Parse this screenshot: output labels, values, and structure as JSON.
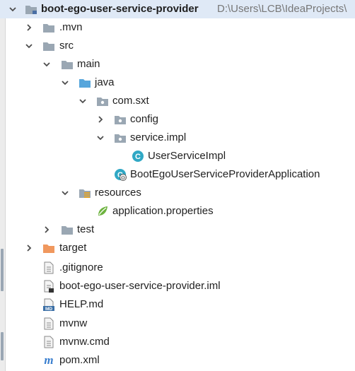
{
  "project_tree": {
    "root": {
      "name": "boot-ego-user-service-provider",
      "path": "D:\\Users\\LCB\\IdeaProjects\\"
    },
    "items": [
      {
        "name": ".mvn",
        "icon": "folder-icon",
        "state": "collapsed"
      },
      {
        "name": "src",
        "icon": "folder-icon",
        "state": "expanded"
      },
      {
        "name": "main",
        "icon": "folder-icon",
        "state": "expanded"
      },
      {
        "name": "java",
        "icon": "source-folder-icon",
        "state": "expanded"
      },
      {
        "name": "com.sxt",
        "icon": "package-icon",
        "state": "expanded"
      },
      {
        "name": "config",
        "icon": "package-icon",
        "state": "collapsed"
      },
      {
        "name": "service.impl",
        "icon": "package-icon",
        "state": "expanded"
      },
      {
        "name": "UserServiceImpl",
        "icon": "class-icon",
        "state": "leaf"
      },
      {
        "name": "BootEgoUserServiceProviderApplication",
        "icon": "spring-boot-class-icon",
        "state": "leaf"
      },
      {
        "name": "resources",
        "icon": "resources-folder-icon",
        "state": "expanded"
      },
      {
        "name": "application.properties",
        "icon": "spring-properties-icon",
        "state": "leaf"
      },
      {
        "name": "test",
        "icon": "folder-icon",
        "state": "collapsed"
      },
      {
        "name": "target",
        "icon": "excluded-folder-icon",
        "state": "collapsed"
      },
      {
        "name": ".gitignore",
        "icon": "text-file-icon",
        "state": "leaf"
      },
      {
        "name": "boot-ego-user-service-provider.iml",
        "icon": "iml-file-icon",
        "state": "leaf"
      },
      {
        "name": "HELP.md",
        "icon": "markdown-file-icon",
        "state": "leaf"
      },
      {
        "name": "mvnw",
        "icon": "text-file-icon",
        "state": "leaf"
      },
      {
        "name": "mvnw.cmd",
        "icon": "text-file-icon",
        "state": "leaf"
      },
      {
        "name": "pom.xml",
        "icon": "maven-icon",
        "state": "leaf"
      }
    ]
  },
  "colors": {
    "folder": "#9aa7b3",
    "source_folder": "#57a6dc",
    "excluded_folder": "#f0985e",
    "class": "#30a8c5",
    "spring": "#6db33f",
    "maven": "#3a7fcf",
    "selection": "#dfe9f6"
  }
}
